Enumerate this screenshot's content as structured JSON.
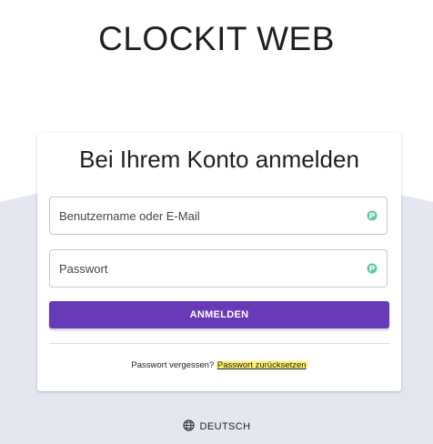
{
  "app": {
    "title": "CLOCKIT WEB"
  },
  "login": {
    "heading": "Bei Ihrem Konto anmelden",
    "username_placeholder": "Benutzername oder E-Mail",
    "password_placeholder": "Passwort",
    "submit_label": "ANMELDEN",
    "forgot_text": "Passwort vergessen?",
    "reset_link": "Passwort zurücksetzen"
  },
  "footer": {
    "language": "DEUTSCH"
  },
  "colors": {
    "primary": "#673ab7",
    "background_lower": "#e4e7f0",
    "highlight": "#fff26a",
    "password_manager_icon": "#5fc9a0"
  },
  "icons": {
    "field_icon": "password-manager-icon",
    "language_icon": "globe-icon"
  }
}
